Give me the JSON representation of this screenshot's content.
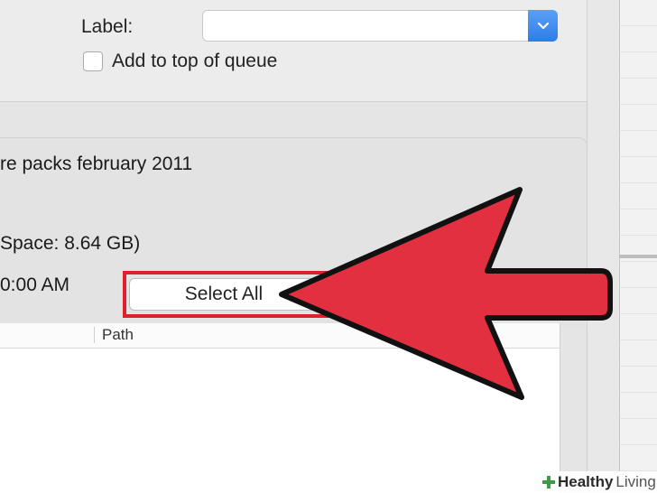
{
  "options": {
    "label_text": "Label:",
    "label_value": "",
    "add_to_top_label": "Add to top of queue",
    "add_to_top_checked": false
  },
  "info": {
    "name_text": "re packs february 2011",
    "space_text": "Space: 8.64 GB)",
    "date_text": "0:00 AM"
  },
  "toolbar": {
    "select_all_label": "Select All"
  },
  "file_list": {
    "columns": [
      "",
      "Path"
    ]
  },
  "watermark": {
    "brand_bold": "Healthy",
    "brand_light": "Living"
  },
  "colors": {
    "accent_blue": "#2d7ce8",
    "highlight_red": "#e0202c",
    "arrow_fill": "#e23040"
  },
  "icons": {
    "dropdown": "chevron-down-icon",
    "arrow": "pointer-arrow-icon",
    "watermark": "healthy-living-logo-icon"
  }
}
